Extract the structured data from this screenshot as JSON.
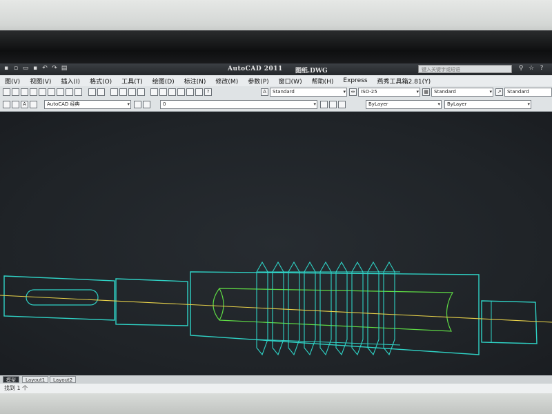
{
  "window": {
    "app_title": "AutoCAD 2011",
    "file_name": "图纸.DWG",
    "search_placeholder": "键入关键字或短语"
  },
  "menu": [
    "图(V)",
    "视图(V)",
    "插入(I)",
    "格式(O)",
    "工具(T)",
    "绘图(D)",
    "标注(N)",
    "修改(M)",
    "参数(P)",
    "窗口(W)",
    "帮助(H)",
    "Express",
    "燕秀工具箱2.81(Y)"
  ],
  "toolbar1": {
    "text_style": "Standard",
    "dim_style": "ISO-25",
    "table_style": "Standard",
    "multileader_style": "Standard"
  },
  "toolbar2": {
    "workspace": "AutoCAD 经典",
    "layer": "0",
    "color": "ByLayer",
    "linetype": "ByLayer"
  },
  "layout_tabs": [
    "模型",
    "Layout1",
    "Layout2"
  ],
  "command_line": "找到 1 个",
  "drawing": {
    "colors": {
      "outline": "#2fd3c6",
      "inner": "#5fdc45",
      "centerline": "#e8d24a",
      "background": "#23282d"
    }
  }
}
